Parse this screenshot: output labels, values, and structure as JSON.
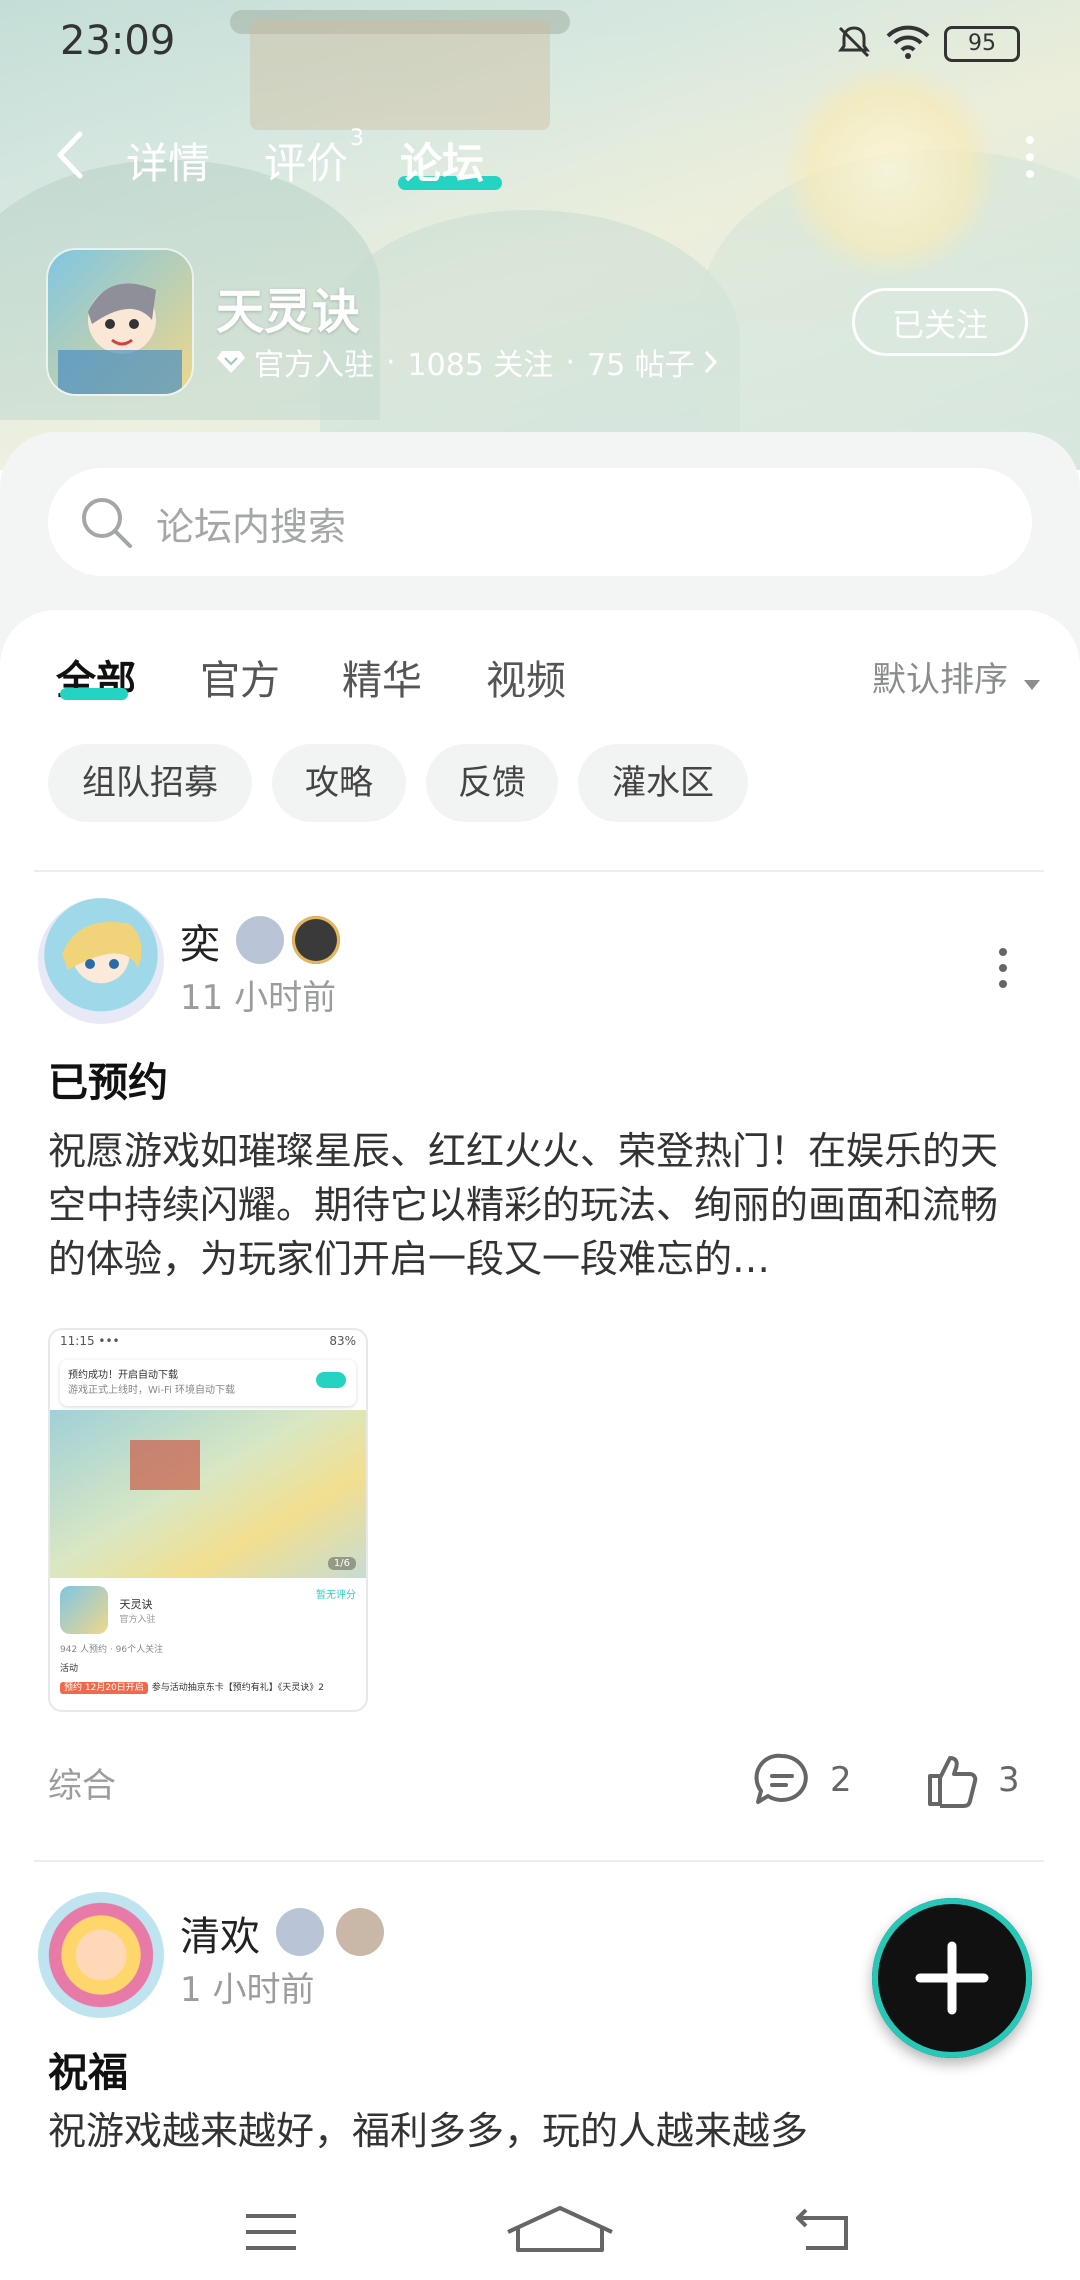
{
  "status_bar": {
    "time": "23:09",
    "battery": "95"
  },
  "nav": {
    "tabs": [
      {
        "label": "详情"
      },
      {
        "label": "评价",
        "badge": "3"
      },
      {
        "label": "论坛"
      }
    ],
    "active_tab": "论坛",
    "accent_color": "#25d3c2"
  },
  "app": {
    "name": "天灵诀",
    "official": "官方入驻",
    "followers": "1085 关注",
    "posts": "75 帖子",
    "follow_button": "已关注"
  },
  "search": {
    "placeholder": "论坛内搜索"
  },
  "filters": {
    "tabs": [
      "全部",
      "官方",
      "精华",
      "视频"
    ],
    "active": "全部",
    "sort": "默认排序"
  },
  "chips": [
    "组队招募",
    "攻略",
    "反馈",
    "灌水区"
  ],
  "posts": [
    {
      "user": "奕",
      "time": "11 小时前",
      "title": "已预约",
      "body": "祝愿游戏如璀璨星辰、红红火火、荣登热门！在娱乐的天空中持续闪耀。期待它以精彩的玩法、绚丽的画面和流畅的体验，为玩家们开启一段又一段难忘的…",
      "image": {
        "time": "11:15 •••",
        "signal": "83%",
        "notif_title": "预约成功！开启自动下载",
        "notif_sub": "游戏正式上线时，Wi-Fi 环境自动下载",
        "page": "1/6",
        "app_name": "天灵诀",
        "official": "官方入驻",
        "rate": "暂无评分",
        "stats": "942 人预约 · 96个人关注",
        "activity": "活动",
        "promo_tag": "预约 12月20日开启",
        "promo_text": "参与活动抽京东卡【预约有礼】《天灵诀》2"
      },
      "category": "综合",
      "comments": "2",
      "likes": "3"
    },
    {
      "user": "清欢",
      "time": "1 小时前",
      "title": "祝福",
      "body": "祝游戏越来越好，福利多多，玩的人越来越多"
    }
  ]
}
